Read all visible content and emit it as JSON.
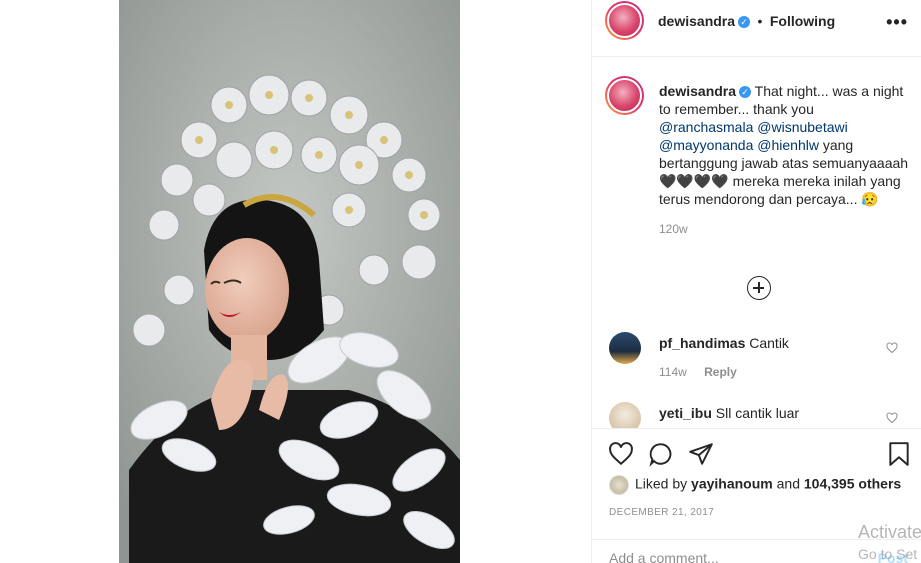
{
  "post": {
    "username": "dewisandra",
    "follow_status": "Following",
    "separator": "•",
    "verified_glyph": "✓",
    "caption": {
      "username": "dewisandra",
      "text_1": "That night... was a night to remember... thank you",
      "mentions": [
        "@ranchasmala",
        "@wisnubetawi",
        "@mayyonanda",
        "@hienhlw"
      ],
      "text_2": "yang bertanggung jawab atas semuanyaaaah",
      "hearts": "🖤🖤🖤🖤",
      "text_3": "mereka mereka inilah yang terus mendorong dan percaya...",
      "emoji_end": "😥",
      "time": "120w"
    },
    "comments": [
      {
        "username": "pf_handimas",
        "text": "Cantik",
        "time": "114w",
        "reply_label": "Reply"
      },
      {
        "username": "yeti_ibu",
        "text": "Sll cantik luar"
      }
    ],
    "likes": {
      "prefix": "Liked by",
      "user": "yayihanoum",
      "conjunction": "and",
      "others": "104,395 others"
    },
    "date": "DECEMBER 21, 2017",
    "add_comment_placeholder": "Add a comment...",
    "post_label": "Post"
  },
  "watermark": {
    "line1": "Activate",
    "line2": "Go to Set"
  },
  "colors": {
    "verified": "#3897f0",
    "mention": "#00376b",
    "muted": "#8e8e8e",
    "border": "#efefef"
  },
  "icons": [
    "more-options-icon",
    "verified-badge-icon",
    "add-circle-icon",
    "heart-icon",
    "comment-icon",
    "share-icon",
    "bookmark-icon"
  ]
}
